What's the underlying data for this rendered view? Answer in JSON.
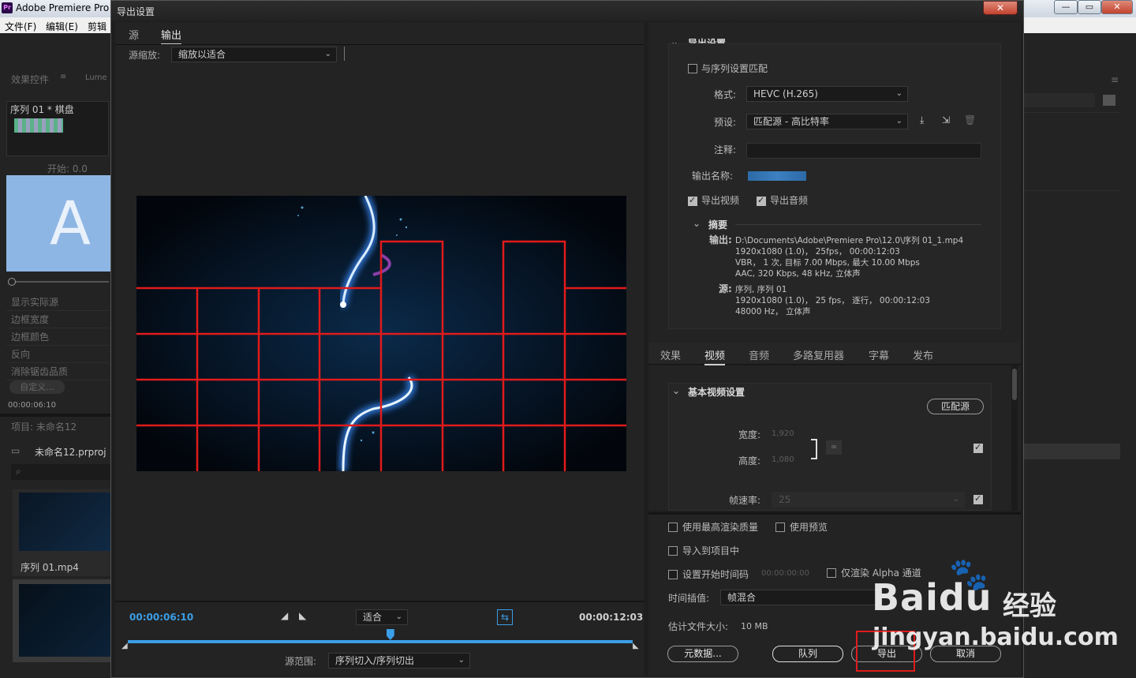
{
  "app": {
    "title": "Adobe Premiere Pro",
    "menu": [
      "文件(F)",
      "编辑(E)",
      "剪辑"
    ],
    "panels": {
      "effect_controls_tab": "效果控件",
      "lumetri_tab": "Lume",
      "sequence_clip": "序列 01 * 棋盘",
      "start_label": "开始: 0.0",
      "big_letter": "A",
      "properties": [
        "显示实际源",
        "边框宽度",
        "边框颜色",
        "反向",
        "消除锯齿品质"
      ],
      "custom_button": "自定义...",
      "timecode": "00:00:06:10",
      "project_title": "项目: 未命名12",
      "project_file": "未命名12.prproj",
      "clip_name": "序列 01.mp4"
    }
  },
  "dialog": {
    "title": "导出设置",
    "close": "✕",
    "left": {
      "tabs": [
        "源",
        "输出"
      ],
      "active_tab": "输出",
      "source_scale_label": "源缩放:",
      "source_scale_value": "缩放以适合",
      "timecode_current": "00:00:06:10",
      "timecode_end": "00:00:12:03",
      "zoom_value": "适合",
      "source_range_label": "源范围:",
      "source_range_value": "序列切入/序列切出",
      "playhead_position": 0.52
    },
    "export_settings": {
      "header": "导出设置",
      "match_sequence": "与序列设置匹配",
      "format_label": "格式:",
      "format_value": "HEVC (H.265)",
      "preset_label": "预设:",
      "preset_value": "匹配源 - 高比特率",
      "comment_label": "注释:",
      "comment_value": "",
      "output_name_label": "输出名称:",
      "export_video": "导出视频",
      "export_audio": "导出音频",
      "summary_header": "摘要",
      "output_label": "输出:",
      "output_lines": [
        "D:\\Documents\\Adobe\\Premiere Pro\\12.0\\序列 01_1.mp4",
        "1920x1080 (1.0)， 25fps， 00:00:12:03",
        "VBR， 1 次, 目标 7.00 Mbps, 最大 10.00 Mbps",
        "AAC, 320 Kbps, 48 kHz, 立体声"
      ],
      "source_label": "源:",
      "source_lines": [
        "序列, 序列 01",
        "1920x1080 (1.0)， 25 fps， 逐行， 00:00:12:03",
        "48000 Hz， 立体声"
      ]
    },
    "tabs2": [
      "效果",
      "视频",
      "音频",
      "多路复用器",
      "字幕",
      "发布"
    ],
    "tabs2_active": "视频",
    "basic_video": {
      "header": "基本视频设置",
      "match_source": "匹配源",
      "width_label": "宽度:",
      "width_value": "1,920",
      "height_label": "高度:",
      "height_value": "1,080",
      "framerate_label": "帧速率:",
      "framerate_value": "25"
    },
    "bottom": {
      "max_render_quality": "使用最高渲染质量",
      "use_previews": "使用预览",
      "import_into_project": "导入到项目中",
      "set_start_timecode": "设置开始时间码",
      "start_timecode_value": "00:00:00:00",
      "render_alpha_only": "仅渲染 Alpha 通道",
      "time_interpolation_label": "时间插值:",
      "time_interpolation_value": "帧混合",
      "file_size_label": "估计文件大小:",
      "file_size_value": "10 MB",
      "metadata_button": "元数据...",
      "queue_button": "队列",
      "export_button": "导出",
      "cancel_button": "取消"
    }
  },
  "watermark": {
    "brand": "Bai",
    "brand2": "du",
    "cn": "经验",
    "url": "jingyan.baidu.com"
  },
  "colors": {
    "accent_blue": "#3b9ee6",
    "highlight_red": "#e01b1b",
    "grid_red": "#e01b1b"
  }
}
